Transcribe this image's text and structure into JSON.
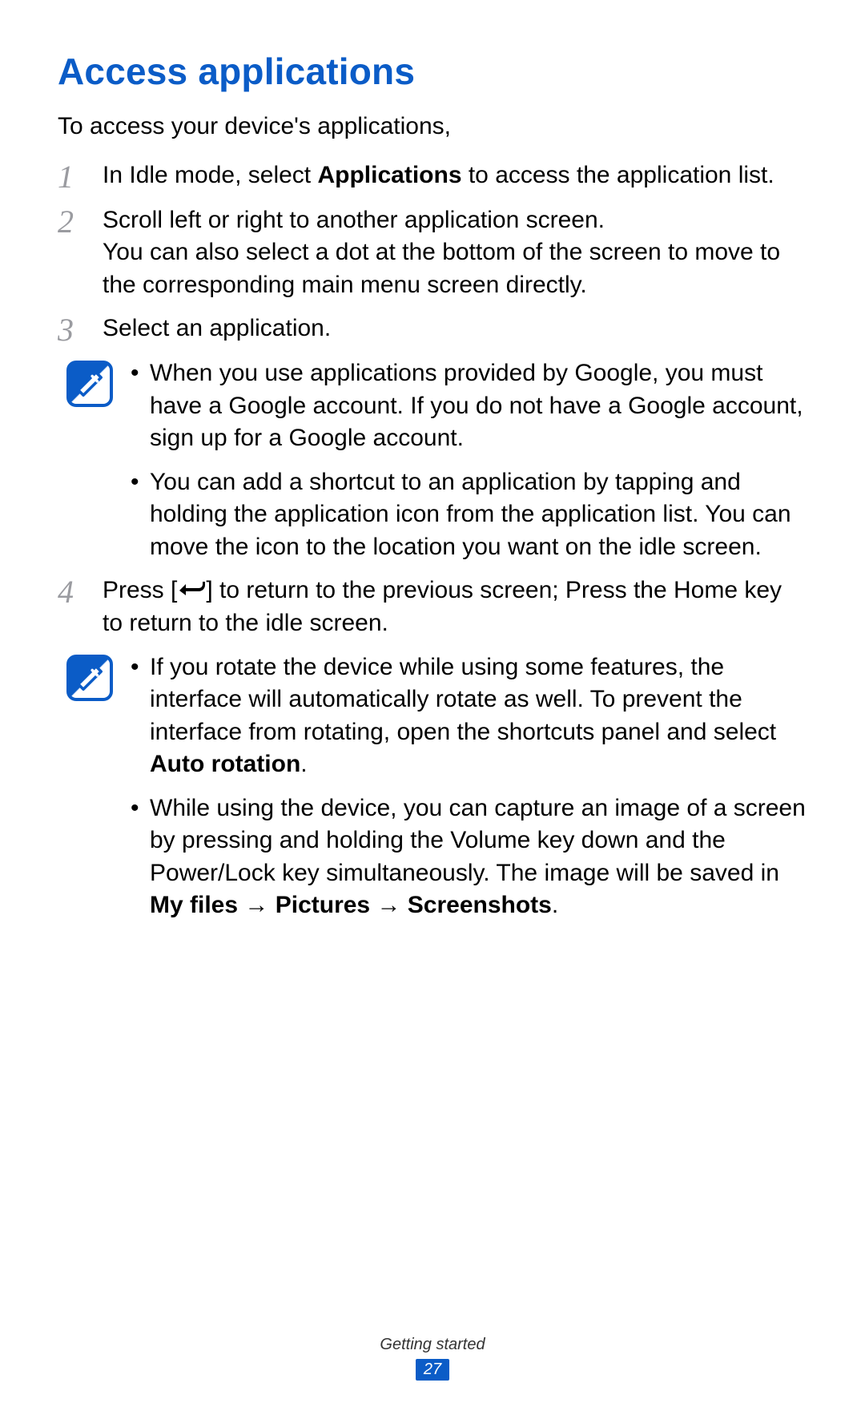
{
  "title": "Access applications",
  "intro": "To access your device's applications,",
  "steps": [
    {
      "num": "1",
      "text_pre": "In Idle mode, select ",
      "bold": "Applications",
      "text_post": " to access the application list."
    },
    {
      "num": "2",
      "line1": "Scroll left or right to another application screen.",
      "line2": "You can also select a dot at the bottom of the screen to move to the corresponding main menu screen directly."
    },
    {
      "num": "3",
      "text": "Select an application."
    }
  ],
  "note1": {
    "item1": "When you use applications provided by Google, you must have a Google account. If you do not have a Google account, sign up for a Google account.",
    "item2": "You can add a shortcut to an application by tapping and holding the application icon from the application list. You can move the icon to the location you want on the idle screen."
  },
  "step4": {
    "num": "4",
    "pre": "Press [",
    "post": "] to return to the previous screen; Press the Home key to return to the idle screen."
  },
  "note2": {
    "item1_pre": "If you rotate the device while using some features, the interface will automatically rotate as well. To prevent the interface from rotating, open the shortcuts panel and select ",
    "item1_bold": "Auto rotation",
    "item1_post": ".",
    "item2_pre": "While using the device, you can capture an image of a screen by pressing and holding the Volume key down and the Power/Lock key simultaneously. The image will be saved in ",
    "item2_path1": "My files",
    "item2_sep": " → ",
    "item2_path2": "Pictures",
    "item2_path3": "Screenshots",
    "item2_post": "."
  },
  "footer": {
    "section": "Getting started",
    "page": "27"
  }
}
